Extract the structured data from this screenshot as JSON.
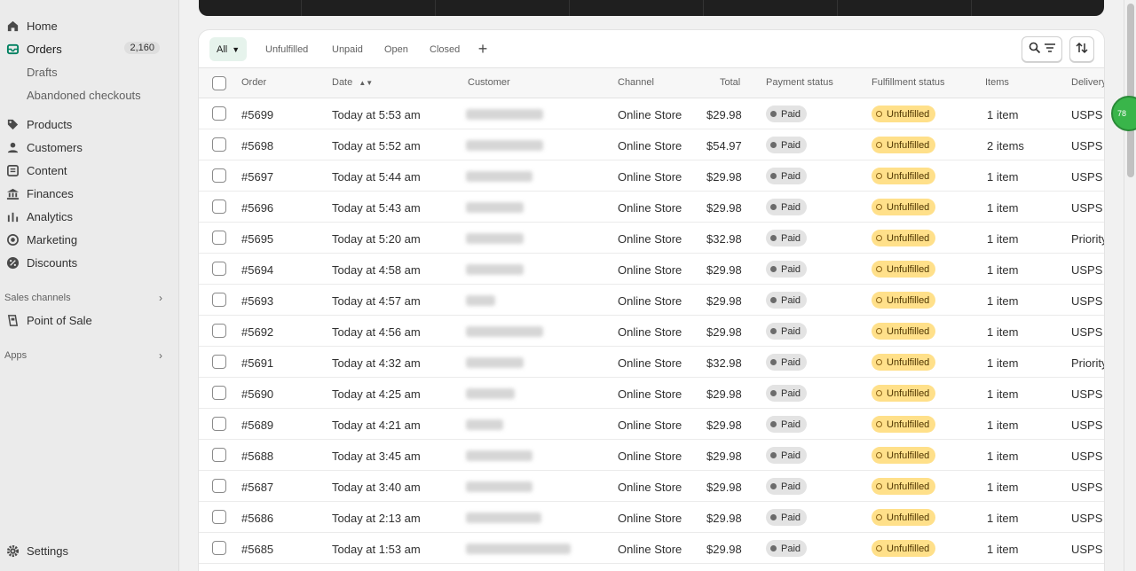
{
  "sidebar": {
    "nav": [
      {
        "label": "Home",
        "icon": "home-icon"
      },
      {
        "label": "Orders",
        "icon": "orders-icon",
        "badge": "2,160"
      },
      {
        "label": "Drafts"
      },
      {
        "label": "Abandoned checkouts"
      },
      {
        "label": "Products",
        "icon": "tag-icon"
      },
      {
        "label": "Customers",
        "icon": "person-icon"
      },
      {
        "label": "Content",
        "icon": "content-icon"
      },
      {
        "label": "Finances",
        "icon": "bank-icon"
      },
      {
        "label": "Analytics",
        "icon": "bar-chart-icon"
      },
      {
        "label": "Marketing",
        "icon": "target-icon"
      },
      {
        "label": "Discounts",
        "icon": "discount-icon"
      }
    ],
    "sales_channels_label": "Sales channels",
    "point_of_sale": "Point of Sale",
    "apps_label": "Apps",
    "settings": "Settings"
  },
  "tabs": [
    "All",
    "Unfulfilled",
    "Unpaid",
    "Open",
    "Closed"
  ],
  "columns": {
    "order": "Order",
    "date": "Date",
    "customer": "Customer",
    "channel": "Channel",
    "total": "Total",
    "payment": "Payment status",
    "fulfillment": "Fulfillment status",
    "items": "Items",
    "delivery": "Delivery"
  },
  "orders": [
    {
      "order": "#5699",
      "date": "Today at 5:53 am",
      "channel": "Online Store",
      "total": "$29.98",
      "payment": "Paid",
      "fulfillment": "Unfulfilled",
      "items": "1 item",
      "delivery": "USPS I"
    },
    {
      "order": "#5698",
      "date": "Today at 5:52 am",
      "channel": "Online Store",
      "total": "$54.97",
      "payment": "Paid",
      "fulfillment": "Unfulfilled",
      "items": "2 items",
      "delivery": "USPS I"
    },
    {
      "order": "#5697",
      "date": "Today at 5:44 am",
      "channel": "Online Store",
      "total": "$29.98",
      "payment": "Paid",
      "fulfillment": "Unfulfilled",
      "items": "1 item",
      "delivery": "USPS I"
    },
    {
      "order": "#5696",
      "date": "Today at 5:43 am",
      "channel": "Online Store",
      "total": "$29.98",
      "payment": "Paid",
      "fulfillment": "Unfulfilled",
      "items": "1 item",
      "delivery": "USPS I"
    },
    {
      "order": "#5695",
      "date": "Today at 5:20 am",
      "channel": "Online Store",
      "total": "$32.98",
      "payment": "Paid",
      "fulfillment": "Unfulfilled",
      "items": "1 item",
      "delivery": "Priority"
    },
    {
      "order": "#5694",
      "date": "Today at 4:58 am",
      "channel": "Online Store",
      "total": "$29.98",
      "payment": "Paid",
      "fulfillment": "Unfulfilled",
      "items": "1 item",
      "delivery": "USPS I"
    },
    {
      "order": "#5693",
      "date": "Today at 4:57 am",
      "channel": "Online Store",
      "total": "$29.98",
      "payment": "Paid",
      "fulfillment": "Unfulfilled",
      "items": "1 item",
      "delivery": "USPS I"
    },
    {
      "order": "#5692",
      "date": "Today at 4:56 am",
      "channel": "Online Store",
      "total": "$29.98",
      "payment": "Paid",
      "fulfillment": "Unfulfilled",
      "items": "1 item",
      "delivery": "USPS I"
    },
    {
      "order": "#5691",
      "date": "Today at 4:32 am",
      "channel": "Online Store",
      "total": "$32.98",
      "payment": "Paid",
      "fulfillment": "Unfulfilled",
      "items": "1 item",
      "delivery": "Priority"
    },
    {
      "order": "#5690",
      "date": "Today at 4:25 am",
      "channel": "Online Store",
      "total": "$29.98",
      "payment": "Paid",
      "fulfillment": "Unfulfilled",
      "items": "1 item",
      "delivery": "USPS I"
    },
    {
      "order": "#5689",
      "date": "Today at 4:21 am",
      "channel": "Online Store",
      "total": "$29.98",
      "payment": "Paid",
      "fulfillment": "Unfulfilled",
      "items": "1 item",
      "delivery": "USPS I"
    },
    {
      "order": "#5688",
      "date": "Today at 3:45 am",
      "channel": "Online Store",
      "total": "$29.98",
      "payment": "Paid",
      "fulfillment": "Unfulfilled",
      "items": "1 item",
      "delivery": "USPS I"
    },
    {
      "order": "#5687",
      "date": "Today at 3:40 am",
      "channel": "Online Store",
      "total": "$29.98",
      "payment": "Paid",
      "fulfillment": "Unfulfilled",
      "items": "1 item",
      "delivery": "USPS I"
    },
    {
      "order": "#5686",
      "date": "Today at 2:13 am",
      "channel": "Online Store",
      "total": "$29.98",
      "payment": "Paid",
      "fulfillment": "Unfulfilled",
      "items": "1 item",
      "delivery": "USPS I"
    },
    {
      "order": "#5685",
      "date": "Today at 1:53 am",
      "channel": "Online Store",
      "total": "$29.98",
      "payment": "Paid",
      "fulfillment": "Unfulfilled",
      "items": "1 item",
      "delivery": "USPS I"
    }
  ],
  "widget_label": "78",
  "colors": {
    "accent": "#008060",
    "unfulfilled": "#ffe08a",
    "paid": "#e3e3e3"
  }
}
